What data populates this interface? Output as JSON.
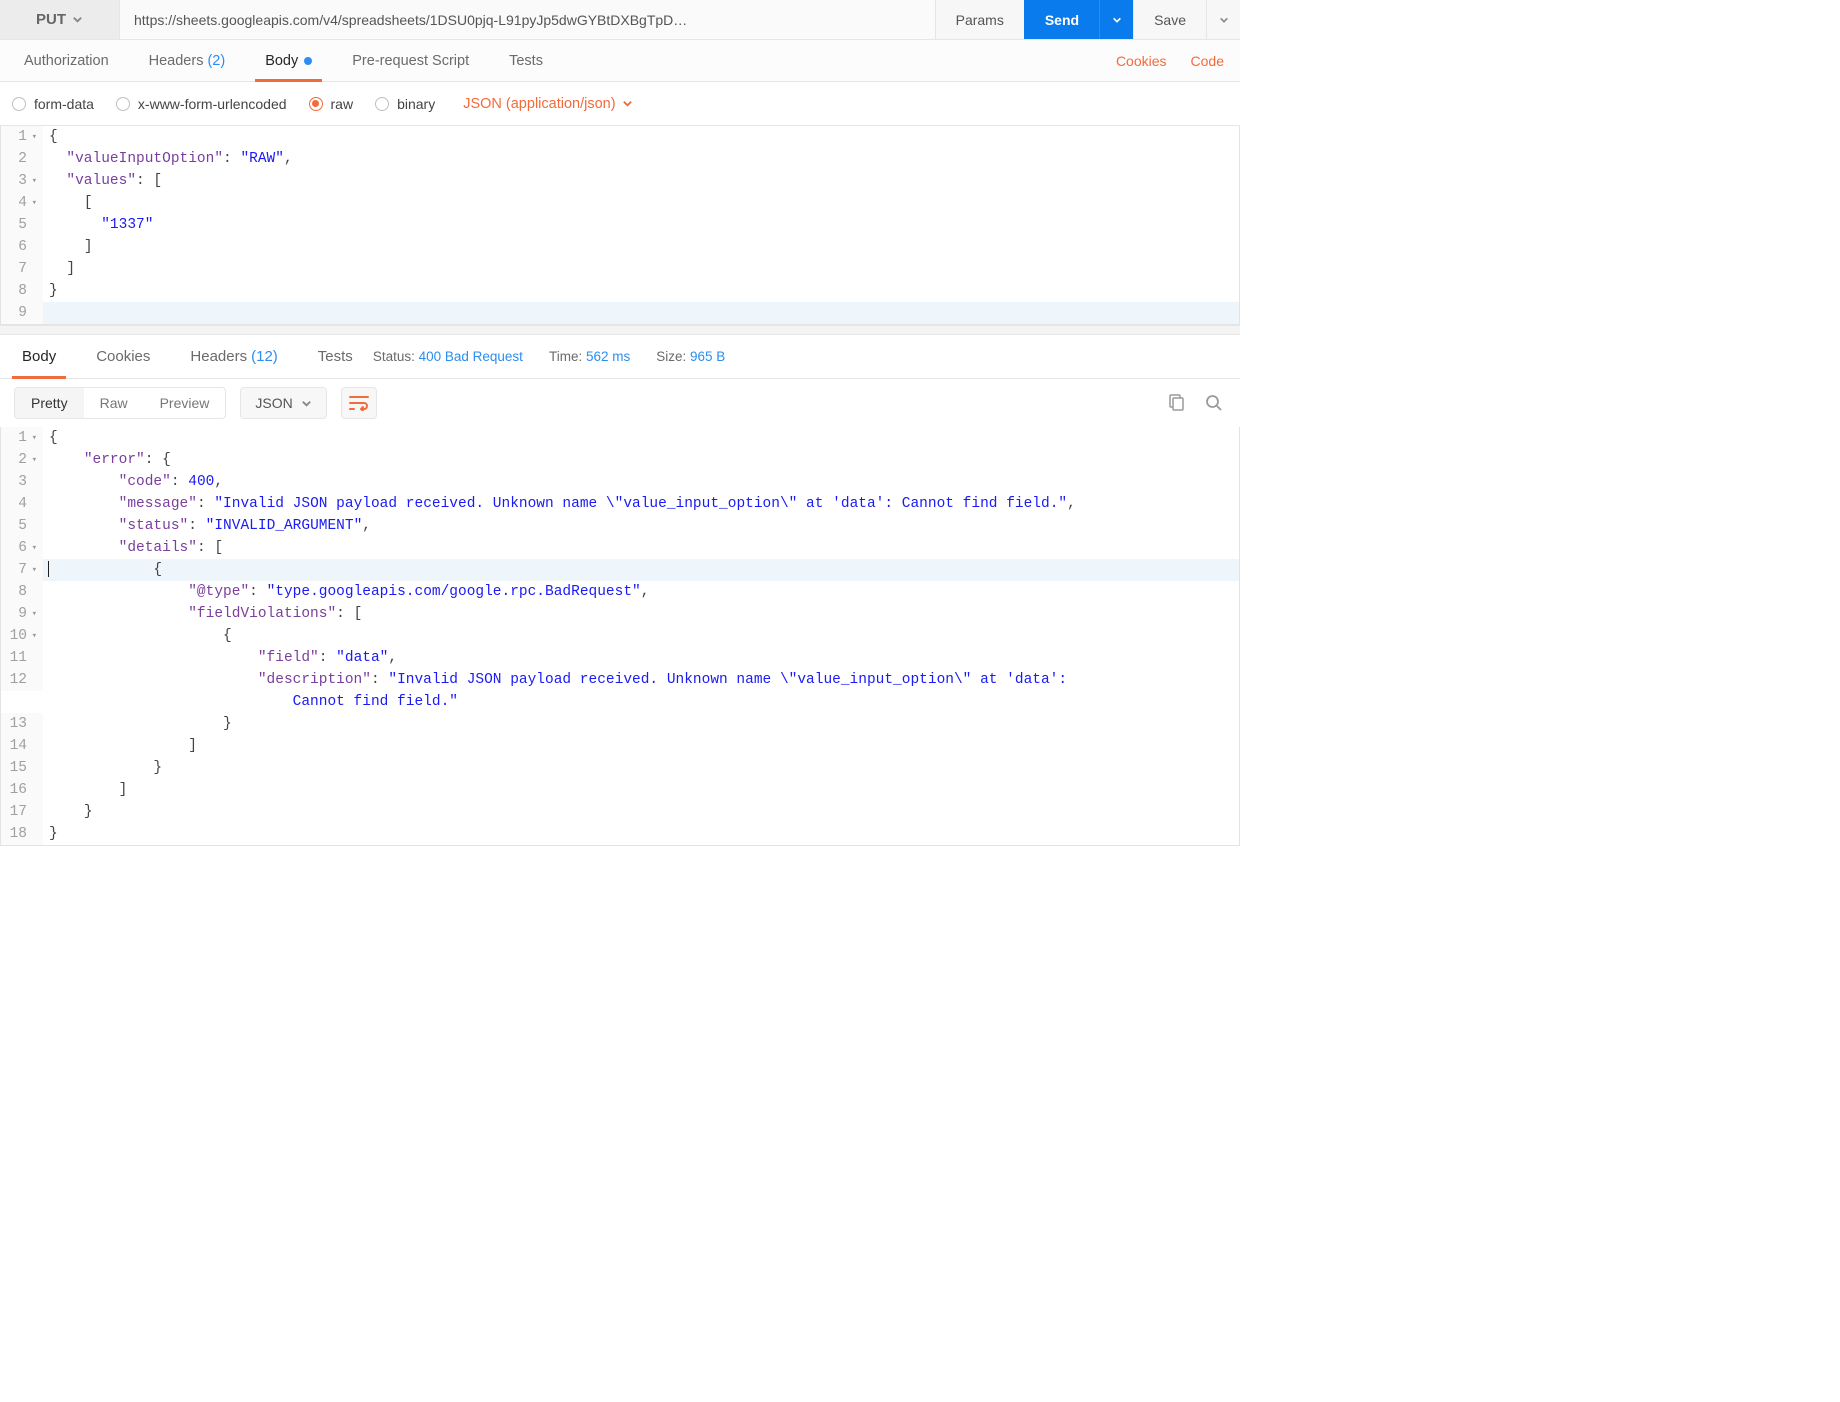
{
  "request": {
    "method": "PUT",
    "url": "https://sheets.googleapis.com/v4/spreadsheets/1DSU0pjq-L91pyJp5dwGYBtDXBgTpD…",
    "params_btn": "Params",
    "send_btn": "Send",
    "save_btn": "Save"
  },
  "req_tabs": {
    "authorization": "Authorization",
    "headers": "Headers",
    "headers_count": "(2)",
    "body": "Body",
    "prerequest": "Pre-request Script",
    "tests": "Tests",
    "cookies_link": "Cookies",
    "code_link": "Code"
  },
  "body_types": {
    "form_data": "form-data",
    "xwww": "x-www-form-urlencoded",
    "raw": "raw",
    "binary": "binary",
    "content_type": "JSON (application/json)"
  },
  "req_body_lines": [
    {
      "n": "1",
      "fold": true,
      "html": "<span class='tok-punct'>{</span>"
    },
    {
      "n": "2",
      "html": "  <span class='tok-key'>\"valueInputOption\"</span><span class='tok-punct'>: </span><span class='tok-str'>\"RAW\"</span><span class='tok-punct'>,</span>"
    },
    {
      "n": "3",
      "fold": true,
      "html": "  <span class='tok-key'>\"values\"</span><span class='tok-punct'>: [</span>"
    },
    {
      "n": "4",
      "fold": true,
      "html": "    <span class='tok-punct'>[</span>"
    },
    {
      "n": "5",
      "html": "      <span class='tok-str'>\"1337\"</span>"
    },
    {
      "n": "6",
      "html": "    <span class='tok-punct'>]</span>"
    },
    {
      "n": "7",
      "html": "  <span class='tok-punct'>]</span>"
    },
    {
      "n": "8",
      "html": "<span class='tok-punct'>}</span>"
    },
    {
      "n": "9",
      "html": "&nbsp;",
      "hl": true
    }
  ],
  "resp_tabs": {
    "body": "Body",
    "cookies": "Cookies",
    "headers": "Headers",
    "headers_count": "(12)",
    "tests": "Tests"
  },
  "resp_meta": {
    "status_label": "Status:",
    "status_value": "400 Bad Request",
    "time_label": "Time:",
    "time_value": "562 ms",
    "size_label": "Size:",
    "size_value": "965 B"
  },
  "resp_toolbar": {
    "pretty": "Pretty",
    "raw": "Raw",
    "preview": "Preview",
    "format": "JSON"
  },
  "resp_body_lines": [
    {
      "n": "1",
      "fold": true,
      "html": "<span class='tok-punct'>{</span>"
    },
    {
      "n": "2",
      "fold": true,
      "html": "    <span class='tok-key'>\"error\"</span><span class='tok-punct'>: {</span>"
    },
    {
      "n": "3",
      "html": "        <span class='tok-key'>\"code\"</span><span class='tok-punct'>: </span><span class='tok-num'>400</span><span class='tok-punct'>,</span>"
    },
    {
      "n": "4",
      "html": "        <span class='tok-key'>\"message\"</span><span class='tok-punct'>: </span><span class='tok-str'>\"Invalid JSON payload received. Unknown name \\\"value_input_option\\\" at 'data': Cannot find field.\"</span><span class='tok-punct'>,</span>"
    },
    {
      "n": "5",
      "html": "        <span class='tok-key'>\"status\"</span><span class='tok-punct'>: </span><span class='tok-str'>\"INVALID_ARGUMENT\"</span><span class='tok-punct'>,</span>"
    },
    {
      "n": "6",
      "fold": true,
      "html": "        <span class='tok-key'>\"details\"</span><span class='tok-punct'>: [</span>"
    },
    {
      "n": "7",
      "fold": true,
      "hl": true,
      "cursor": true,
      "html": "            <span class='tok-punct'>{</span>"
    },
    {
      "n": "8",
      "html": "                <span class='tok-key'>\"@type\"</span><span class='tok-punct'>: </span><span class='tok-str'>\"type.googleapis.com/google.rpc.BadRequest\"</span><span class='tok-punct'>,</span>"
    },
    {
      "n": "9",
      "fold": true,
      "html": "                <span class='tok-key'>\"fieldViolations\"</span><span class='tok-punct'>: [</span>"
    },
    {
      "n": "10",
      "fold": true,
      "html": "                    <span class='tok-punct'>{</span>"
    },
    {
      "n": "11",
      "html": "                        <span class='tok-key'>\"field\"</span><span class='tok-punct'>: </span><span class='tok-str'>\"data\"</span><span class='tok-punct'>,</span>"
    },
    {
      "n": "12",
      "html": "                        <span class='tok-key'>\"description\"</span><span class='tok-punct'>: </span><span class='tok-str'>\"Invalid JSON payload received. Unknown name \\\"value_input_option\\\" at 'data':<br>                            Cannot find field.\"</span>"
    },
    {
      "n": "13",
      "html": "                    <span class='tok-punct'>}</span>"
    },
    {
      "n": "14",
      "html": "                <span class='tok-punct'>]</span>"
    },
    {
      "n": "15",
      "html": "            <span class='tok-punct'>}</span>"
    },
    {
      "n": "16",
      "html": "        <span class='tok-punct'>]</span>"
    },
    {
      "n": "17",
      "html": "    <span class='tok-punct'>}</span>"
    },
    {
      "n": "18",
      "html": "<span class='tok-punct'>}</span>"
    }
  ]
}
